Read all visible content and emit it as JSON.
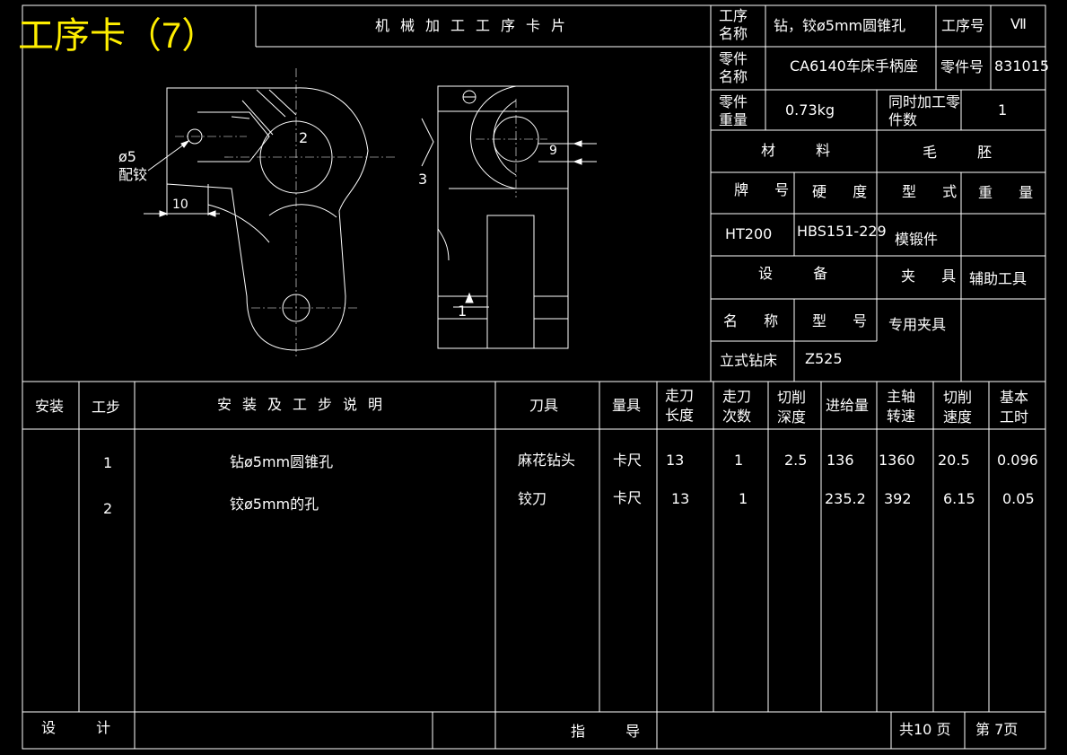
{
  "page_title": "工序卡（7）",
  "sheet_title": "机械加工工序卡片",
  "header": {
    "op_name_label": "工序名称",
    "op_name": "钻，铰ø5mm圆锥孔",
    "op_no_label": "工序号",
    "op_no": "Ⅶ",
    "part_name_label": "零件名称",
    "part_name": "CA6140车床手柄座",
    "part_no_label": "零件号",
    "part_no": "831015",
    "part_weight_label": "零件重量",
    "part_weight": "0.73kg",
    "simul_label": "同时加工零件数",
    "simul": "1"
  },
  "material": {
    "label": "材  料",
    "blank_label": "毛  胚",
    "grade_label": "牌 号",
    "hardness_label": "硬 度",
    "type_label": "型 式",
    "weight_label": "重 量",
    "grade": "HT200",
    "hardness": "HBS151-229",
    "type": "模锻件",
    "weight": ""
  },
  "equipment": {
    "label": "设  备",
    "fixture_label": "夹 具",
    "aux_tool": "辅助工具",
    "name_label": "名 称",
    "model_label": "型 号",
    "fixture": "专用夹具",
    "name": "立式钻床",
    "model": "Z525"
  },
  "drawing": {
    "dia_label": "ø5",
    "ream_label": "配铰",
    "dim_10": "10",
    "dim_9": "9",
    "ref_1": "1",
    "ref_2": "2",
    "ref_3": "3"
  },
  "steps": {
    "headers": [
      "安装",
      "工步",
      "安装及工步说明",
      "刀具",
      "量具",
      "走刀长度",
      "走刀次数",
      "切削深度",
      "进给量",
      "主轴转速",
      "切削速度",
      "基本工时"
    ],
    "rows": [
      {
        "step": "1",
        "desc": "钻ø5mm圆锥孔",
        "tool": "麻花钻头",
        "gauge": "卡尺",
        "len": "13",
        "passes": "1",
        "depth": "2.5",
        "feed": "136",
        "speed": "1360",
        "vc": "20.5",
        "time": "0.096"
      },
      {
        "step": "2",
        "desc": "铰ø5mm的孔",
        "tool": "铰刀",
        "gauge": "卡尺",
        "len": "13",
        "passes": "1",
        "depth": "",
        "feed": "235.2",
        "speed": "392",
        "vc": "6.15",
        "time": "0.05"
      }
    ]
  },
  "footer": {
    "design_label": "设  计",
    "guide_label": "指  导",
    "total": "共10 页",
    "page": "第  7页"
  }
}
